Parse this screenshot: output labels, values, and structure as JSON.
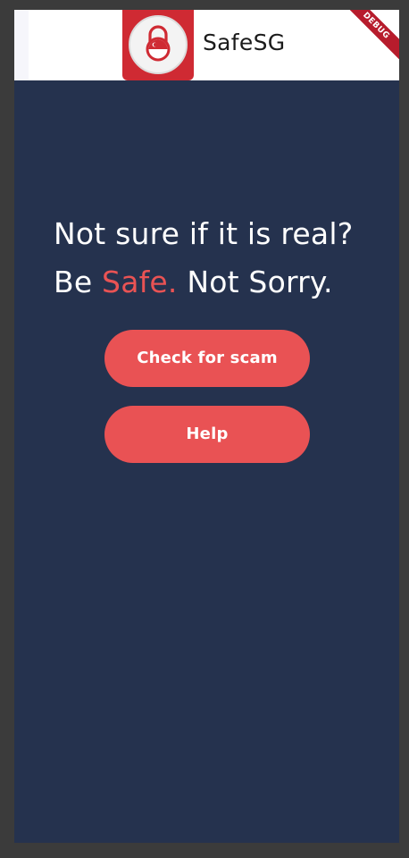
{
  "app_bar": {
    "title": "SafeSG",
    "debug_banner": "DEBUG"
  },
  "hero": {
    "line1": "Not sure if it is real?",
    "line2_prefix": "Be ",
    "line2_highlight": "Safe.",
    "line2_suffix": " Not Sorry."
  },
  "buttons": {
    "check_label": "Check for scam",
    "help_label": "Help"
  },
  "colors": {
    "background": "#25324e",
    "accent": "#e95254",
    "logo_red": "#cf2a33",
    "app_bar": "#ffffff"
  }
}
